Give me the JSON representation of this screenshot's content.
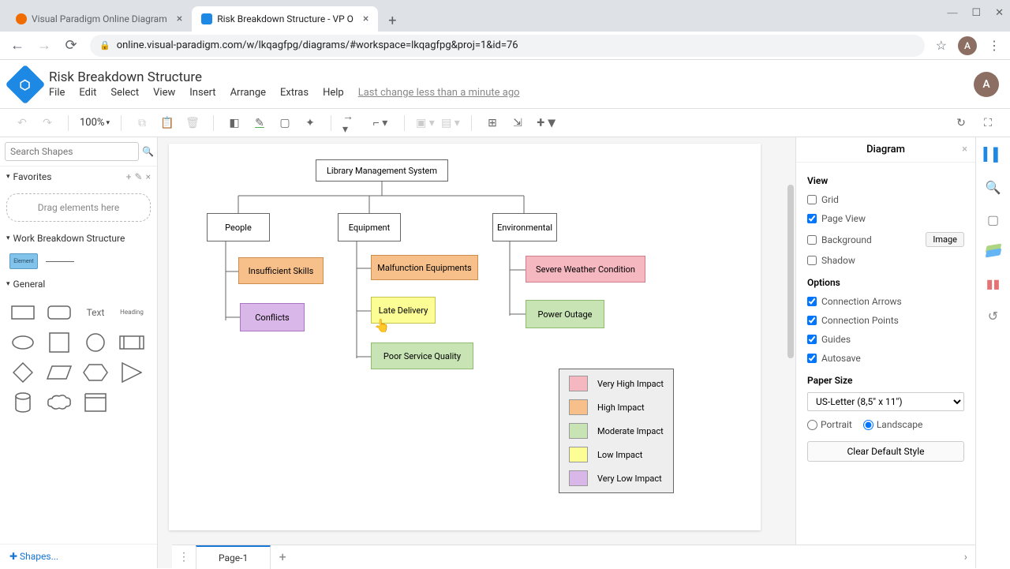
{
  "browser": {
    "tabs": [
      {
        "title": "Visual Paradigm Online Diagram",
        "active": false,
        "favicon_bg": "#ef6c00"
      },
      {
        "title": "Risk Breakdown Structure - VP O",
        "active": true,
        "favicon_bg": "#1e88e5"
      }
    ],
    "url": "online.visual-paradigm.com/w/lkqagfpg/diagrams/#workspace=lkqagfpg&proj=1&id=76",
    "avatar_letter": "A"
  },
  "header": {
    "doc_title": "Risk Breakdown Structure",
    "menu": [
      "File",
      "Edit",
      "Select",
      "View",
      "Insert",
      "Arrange",
      "Extras",
      "Help"
    ],
    "last_change": "Last change less than a minute ago",
    "avatar_letter": "A"
  },
  "toolbar": {
    "zoom": "100%"
  },
  "left": {
    "search_placeholder": "Search Shapes",
    "favorites": "Favorites",
    "drag_hint": "Drag elements here",
    "wbs": "Work Breakdown Structure",
    "element_label": "Element",
    "general": "General",
    "text_label": "Text",
    "heading_label": "Heading",
    "shapes_btn": "Shapes..."
  },
  "diagram": {
    "root": "Library Management System",
    "c1": "People",
    "c2": "Equipment",
    "c3": "Environmental",
    "l1a": "Insufficient Skills",
    "l1b": "Conflicts",
    "l2a": "Malfunction Equipments",
    "l2b": "Late Delivery",
    "l2c": "Poor Service Quality",
    "l3a": "Severe Weather Condition",
    "l3b": "Power Outage",
    "legend": {
      "vhi": "Very High Impact",
      "hi": "High Impact",
      "mi": "Moderate Impact",
      "li": "Low Impact",
      "vli": "Very Low Impact"
    }
  },
  "right": {
    "title": "Diagram",
    "view": "View",
    "grid": "Grid",
    "page_view": "Page View",
    "background": "Background",
    "image_btn": "Image",
    "shadow": "Shadow",
    "options": "Options",
    "conn_arrows": "Connection Arrows",
    "conn_points": "Connection Points",
    "guides": "Guides",
    "autosave": "Autosave",
    "paper_size": "Paper Size",
    "paper_value": "US-Letter (8,5\" x 11\")",
    "portrait": "Portrait",
    "landscape": "Landscape",
    "clear_btn": "Clear Default Style",
    "checks": {
      "grid": false,
      "page_view": true,
      "background": false,
      "shadow": false,
      "conn_arrows": true,
      "conn_points": true,
      "guides": true,
      "autosave": true
    }
  },
  "pages": {
    "tab1": "Page-1"
  }
}
